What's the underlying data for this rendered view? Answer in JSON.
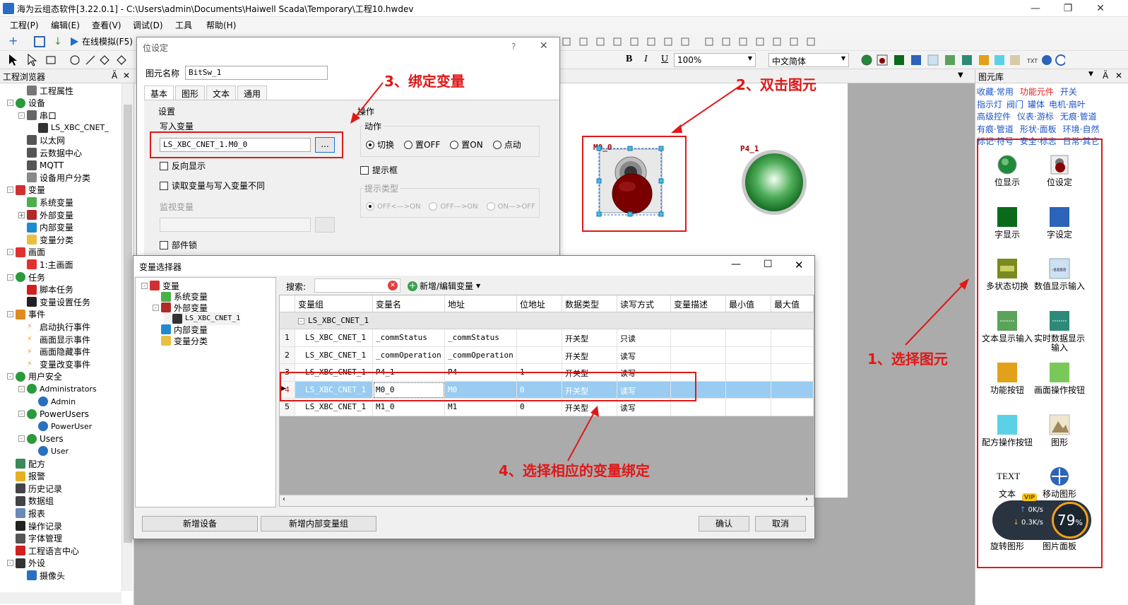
{
  "window": {
    "title": "海为云组态软件[3.22.0.1] - C:\\Users\\admin\\Documents\\Haiwell Scada\\Temporary\\工程10.hwdev"
  },
  "menu": [
    "工程(P)",
    "编辑(E)",
    "查看(V)",
    "调试(D)",
    "工具",
    "帮助(H)"
  ],
  "toolbar": {
    "simulate_label": "在线模拟(F5)",
    "zoom": "100%",
    "font": "中文简体",
    "bold": "B",
    "italic": "I",
    "underline": "U"
  },
  "left_panel": {
    "title": "工程浏览器",
    "tree": [
      {
        "label": "工程属性",
        "level": 2,
        "icon": "properties-icon"
      },
      {
        "label": "设备",
        "level": 1,
        "icon": "device-icon",
        "expander": "-"
      },
      {
        "label": "串口",
        "level": 2,
        "icon": "serial-port-icon",
        "expander": "-"
      },
      {
        "label": "LS_XBC_CNET_",
        "level": 3,
        "icon": "plc-icon"
      },
      {
        "label": "以太网",
        "level": 2,
        "icon": "ethernet-icon"
      },
      {
        "label": "云数据中心",
        "level": 2,
        "icon": "cloud-icon"
      },
      {
        "label": "MQTT",
        "level": 2,
        "icon": "mqtt-icon"
      },
      {
        "label": "设备用户分类",
        "level": 2,
        "icon": "category-icon"
      },
      {
        "label": "变量",
        "level": 1,
        "icon": "variable-icon",
        "expander": "-"
      },
      {
        "label": "系统变量",
        "level": 2,
        "icon": "system-var-icon"
      },
      {
        "label": "外部变量",
        "level": 2,
        "icon": "external-var-icon",
        "expander": "+"
      },
      {
        "label": "内部变量",
        "level": 2,
        "icon": "internal-var-icon"
      },
      {
        "label": "变量分类",
        "level": 2,
        "icon": "folder-icon"
      },
      {
        "label": "画面",
        "level": 1,
        "icon": "screen-icon",
        "expander": "-"
      },
      {
        "label": "1:主画面",
        "level": 2,
        "icon": "main-screen-icon"
      },
      {
        "label": "任务",
        "level": 1,
        "icon": "task-icon",
        "expander": "-"
      },
      {
        "label": "脚本任务",
        "level": 2,
        "icon": "script-icon"
      },
      {
        "label": "变量设置任务",
        "level": 2,
        "icon": "var-task-icon"
      },
      {
        "label": "事件",
        "level": 1,
        "icon": "event-icon",
        "expander": "-"
      },
      {
        "label": "启动执行事件",
        "level": 2,
        "icon": "lightning-icon"
      },
      {
        "label": "画面显示事件",
        "level": 2,
        "icon": "lightning-icon"
      },
      {
        "label": "画面隐藏事件",
        "level": 2,
        "icon": "lightning-icon"
      },
      {
        "label": "变量改变事件",
        "level": 2,
        "icon": "lightning-icon"
      },
      {
        "label": "用户安全",
        "level": 1,
        "icon": "users-icon",
        "expander": "-"
      },
      {
        "label": "Administrators",
        "level": 2,
        "icon": "users-icon",
        "expander": "-"
      },
      {
        "label": "Admin",
        "level": 3,
        "icon": "user-icon"
      },
      {
        "label": "PowerUsers",
        "level": 2,
        "icon": "users-icon",
        "expander": "-"
      },
      {
        "label": "PowerUser",
        "level": 3,
        "icon": "user-icon"
      },
      {
        "label": "Users",
        "level": 2,
        "icon": "users-icon",
        "expander": "-"
      },
      {
        "label": "User",
        "level": 3,
        "icon": "user-icon"
      },
      {
        "label": "配方",
        "level": 1,
        "icon": "recipe-icon"
      },
      {
        "label": "报警",
        "level": 1,
        "icon": "bell-icon"
      },
      {
        "label": "历史记录",
        "level": 1,
        "icon": "history-icon"
      },
      {
        "label": "数据组",
        "level": 1,
        "icon": "datagroup-icon"
      },
      {
        "label": "报表",
        "level": 1,
        "icon": "report-icon"
      },
      {
        "label": "操作记录",
        "level": 1,
        "icon": "oplog-icon"
      },
      {
        "label": "字体管理",
        "level": 1,
        "icon": "font-icon"
      },
      {
        "label": "工程语言中心",
        "level": 1,
        "icon": "language-icon"
      },
      {
        "label": "外设",
        "level": 1,
        "icon": "tools-icon",
        "expander": "-"
      },
      {
        "label": "摄像头",
        "level": 2,
        "icon": "camera-icon"
      }
    ]
  },
  "canvas": {
    "element1_label": "M0_0",
    "element2_label": "P4_1"
  },
  "right_panel": {
    "title": "图元库",
    "categories": [
      [
        "收藏·常用",
        "功能元件",
        "开关"
      ],
      [
        "指示灯",
        "阀门",
        "罐体",
        "电机·扇叶"
      ],
      [
        "高级控件",
        "仪表·游标",
        "无痕·管道"
      ],
      [
        "有痕·管道",
        "形状·面板",
        "环境·自然"
      ],
      [
        "标记·符号",
        "安全·标志",
        "日常·其它"
      ]
    ],
    "active_category": "功能元件",
    "items": [
      {
        "label": "位显示",
        "icon": "bit-display-icon"
      },
      {
        "label": "位设定",
        "icon": "bit-set-icon"
      },
      {
        "label": "字显示",
        "icon": "word-display-icon"
      },
      {
        "label": "字设定",
        "icon": "word-set-icon"
      },
      {
        "label": "多状态切换",
        "icon": "multistate-icon"
      },
      {
        "label": "数值显示输入",
        "icon": "numeric-io-icon"
      },
      {
        "label": "文本显示输入",
        "icon": "text-io-icon"
      },
      {
        "label": "实时数据显示输入",
        "icon": "realtime-data-icon"
      },
      {
        "label": "功能按钮",
        "icon": "function-button-icon"
      },
      {
        "label": "画面操作按钮",
        "icon": "screen-button-icon"
      },
      {
        "label": "配方操作按钮",
        "icon": "recipe-button-icon"
      },
      {
        "label": "图形",
        "icon": "image-icon"
      },
      {
        "label": "文本",
        "icon": "text-icon",
        "glyph": "TEXT"
      },
      {
        "label": "移动图形",
        "icon": "move-icon"
      },
      {
        "label": "旋转图形",
        "icon": "rotate-icon"
      },
      {
        "label": "图片面板",
        "icon": "picture-panel-icon"
      }
    ],
    "net_widget": {
      "up": "0K/s",
      "down": "0.3K/s",
      "percent": "79",
      "percent_sign": "%",
      "vip": "VIP"
    }
  },
  "dialog_bit": {
    "title": "位设定",
    "help": "?",
    "name_label": "图元名称",
    "name_value": "BitSw_1",
    "tabs": [
      "基本",
      "图形",
      "文本",
      "通用"
    ],
    "settings_group": "设置",
    "write_var_label": "写入变量",
    "write_var_value": "LS_XBC_CNET_1.M0_0",
    "browse_btn": "...",
    "reverse_display": "反向显示",
    "read_write_diff": "读取变量与写入变量不同",
    "monitor_var_label": "监视变量",
    "component_lock": "部件锁",
    "operation_group": "操作",
    "action_group": "动作",
    "actions": [
      "切换",
      "置OFF",
      "置ON",
      "点动"
    ],
    "tip_box": "提示框",
    "tip_type_group": "提示类型",
    "tip_types": [
      "OFF<—>ON",
      "OFF—>ON",
      "ON—>OFF"
    ]
  },
  "dialog_var": {
    "title": "变量选择器",
    "tree": [
      {
        "label": "变量",
        "level": 0,
        "icon": "variable-icon",
        "expander": "-"
      },
      {
        "label": "系统变量",
        "level": 1,
        "icon": "system-var-icon"
      },
      {
        "label": "外部变量",
        "level": 1,
        "icon": "external-var-icon",
        "expander": "-"
      },
      {
        "label": "LS_XBC_CNET_1",
        "level": 2,
        "icon": "plc-icon"
      },
      {
        "label": "内部变量",
        "level": 1,
        "icon": "internal-var-icon"
      },
      {
        "label": "变量分类",
        "level": 1,
        "icon": "folder-icon"
      }
    ],
    "search_label": "搜索:",
    "add_edit_label": "新增/编辑变量",
    "columns": [
      "变量组",
      "变量名",
      "地址",
      "位地址",
      "数据类型",
      "读写方式",
      "变量描述",
      "最小值",
      "最大值"
    ],
    "group_row": "LS_XBC_CNET_1",
    "rows": [
      {
        "idx": "1",
        "group": "LS_XBC_CNET_1",
        "name": "_commStatus",
        "addr": "_commStatus",
        "bit": "",
        "type": "开关型",
        "rw": "只读",
        "desc": "",
        "min": "",
        "max": ""
      },
      {
        "idx": "2",
        "group": "LS_XBC_CNET_1",
        "name": "_commOperation",
        "addr": "_commOperation",
        "bit": "",
        "type": "开关型",
        "rw": "读写",
        "desc": "",
        "min": "",
        "max": ""
      },
      {
        "idx": "3",
        "group": "LS_XBC_CNET_1",
        "name": "P4_1",
        "addr": "P4",
        "bit": "1",
        "type": "开关型",
        "rw": "读写",
        "desc": "",
        "min": "",
        "max": ""
      },
      {
        "idx": "4",
        "group": "LS_XBC_CNET_1",
        "name": "M0_0",
        "addr": "M0",
        "bit": "0",
        "type": "开关型",
        "rw": "读写",
        "desc": "",
        "min": "",
        "max": ""
      },
      {
        "idx": "5",
        "group": "LS_XBC_CNET_1",
        "name": "M1_0",
        "addr": "M1",
        "bit": "0",
        "type": "开关型",
        "rw": "读写",
        "desc": "",
        "min": "",
        "max": ""
      }
    ],
    "selected_row": 3,
    "btn_add_device": "新增设备",
    "btn_add_group": "新增内部变量组",
    "btn_ok": "确认",
    "btn_cancel": "取消"
  },
  "annotations": {
    "a1": "1、选择图元",
    "a2": "2、双击图元",
    "a3": "3、绑定变量",
    "a4": "4、选择相应的变量绑定"
  },
  "colors": {
    "accent_red": "#e01818",
    "selection_blue": "#99ccf0",
    "link_blue": "#1e56c8"
  }
}
